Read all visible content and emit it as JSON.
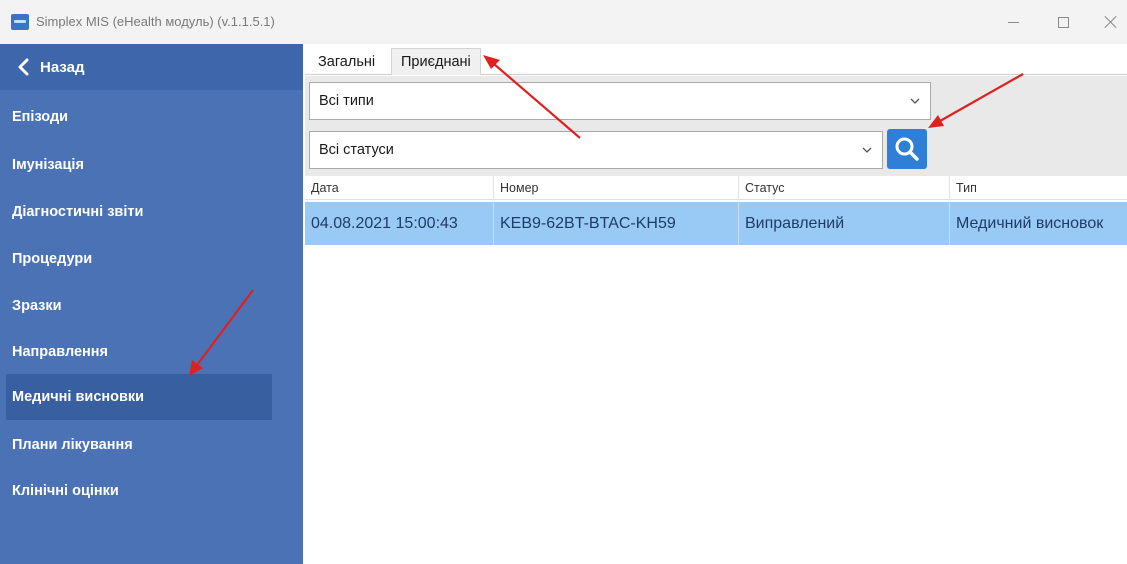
{
  "window": {
    "title": "Simplex MIS (eHealth модуль) (v.1.1.5.1)"
  },
  "sidebar": {
    "back_label": "Назад",
    "items": [
      {
        "label": "Епізоди"
      },
      {
        "label": "Імунізація"
      },
      {
        "label": "Діагностичні звіти"
      },
      {
        "label": "Процедури"
      },
      {
        "label": "Зразки"
      },
      {
        "label": "Направлення"
      },
      {
        "label": "Медичні висновки",
        "active": true
      },
      {
        "label": "Плани лікування"
      },
      {
        "label": "Клінічні оцінки"
      }
    ],
    "colors": {
      "background": "#4a72b5",
      "active": "#385f9f"
    }
  },
  "tabs": [
    {
      "label": "Загальні"
    },
    {
      "label": "Приєднані",
      "selected": true
    }
  ],
  "filters": {
    "type_select": {
      "value": "Всі типи"
    },
    "status_select": {
      "value": "Всі статуси"
    },
    "search_icon": "search-icon"
  },
  "table": {
    "columns": [
      "Дата",
      "Номер",
      "Статус",
      "Тип"
    ],
    "rows": [
      {
        "date": "04.08.2021 15:00:43",
        "number": "KEB9-62BT-BTAC-KH59",
        "status": "Виправлений",
        "type": "Медичний висновок"
      }
    ],
    "selected_row_color": "#99c9f5"
  },
  "annotation_color": "#e0201e"
}
